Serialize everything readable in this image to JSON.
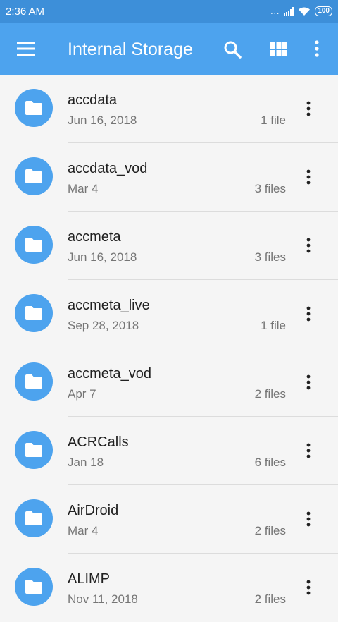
{
  "status_bar": {
    "time": "2:36  AM",
    "signal_dots": "...",
    "battery": "100"
  },
  "app_bar": {
    "title": "Internal Storage"
  },
  "files": [
    {
      "name": "accdata",
      "date": "Jun 16, 2018",
      "count": "1 file"
    },
    {
      "name": "accdata_vod",
      "date": "Mar 4",
      "count": "3 files"
    },
    {
      "name": "accmeta",
      "date": "Jun 16, 2018",
      "count": "3 files"
    },
    {
      "name": "accmeta_live",
      "date": "Sep 28, 2018",
      "count": "1 file"
    },
    {
      "name": "accmeta_vod",
      "date": "Apr 7",
      "count": "2 files"
    },
    {
      "name": "ACRCalls",
      "date": "Jan 18",
      "count": "6 files"
    },
    {
      "name": "AirDroid",
      "date": "Mar 4",
      "count": "2 files"
    },
    {
      "name": "ALIMP",
      "date": "Nov 11, 2018",
      "count": "2 files"
    }
  ],
  "colors": {
    "status_bar": "#3d8fd9",
    "app_bar": "#4da3ee",
    "folder_circle": "#4da3ee",
    "background": "#f5f5f5"
  }
}
